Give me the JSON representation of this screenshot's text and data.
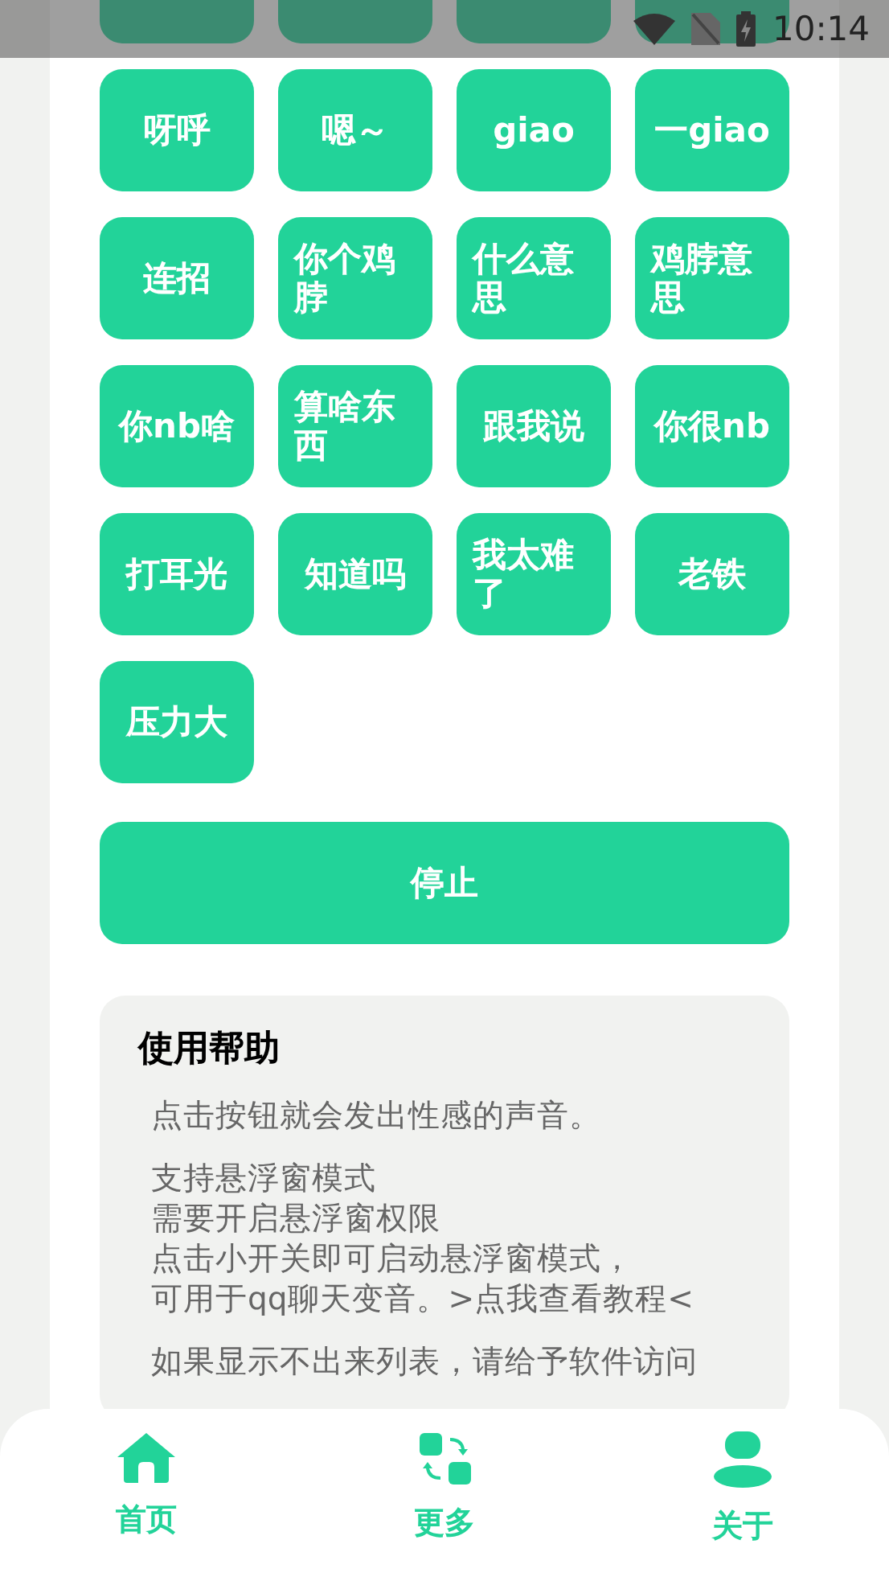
{
  "status_bar": {
    "time": "10:14"
  },
  "sound_buttons": [
    {
      "kind": "cut"
    },
    {
      "kind": "cut"
    },
    {
      "kind": "cut"
    },
    {
      "kind": "cut"
    },
    {
      "kind": "sound",
      "label": "呀呼"
    },
    {
      "kind": "sound",
      "label": "嗯～"
    },
    {
      "kind": "sound",
      "label": "giao"
    },
    {
      "kind": "sound",
      "label": "一giao"
    },
    {
      "kind": "sound",
      "label": "连招"
    },
    {
      "kind": "sound",
      "label": "你个鸡脖"
    },
    {
      "kind": "sound",
      "label": "什么意思"
    },
    {
      "kind": "sound",
      "label": "鸡脖意思"
    },
    {
      "kind": "sound",
      "label": "你nb啥"
    },
    {
      "kind": "sound",
      "label": "算啥东西"
    },
    {
      "kind": "sound",
      "label": "跟我说"
    },
    {
      "kind": "sound",
      "label": "你很nb"
    },
    {
      "kind": "sound",
      "label": "打耳光"
    },
    {
      "kind": "sound",
      "label": "知道吗"
    },
    {
      "kind": "sound",
      "label": "我太难了"
    },
    {
      "kind": "sound",
      "label": "老铁"
    },
    {
      "kind": "sound",
      "label": "压力大"
    }
  ],
  "stop_button": "停止",
  "help": {
    "title": "使用帮助",
    "paragraphs": [
      [
        "点击按钮就会发出性感的声音。"
      ],
      [
        "支持悬浮窗模式",
        "需要开启悬浮窗权限",
        "点击小开关即可启动悬浮窗模式，",
        "可用于qq聊天变音。>点我查看教程<"
      ],
      [
        "如果显示不出来列表，请给予软件访问"
      ]
    ]
  },
  "bottom_nav": [
    {
      "kind": "home",
      "label": "首页"
    },
    {
      "kind": "more",
      "label": "更多"
    },
    {
      "kind": "about",
      "label": "关于"
    }
  ]
}
